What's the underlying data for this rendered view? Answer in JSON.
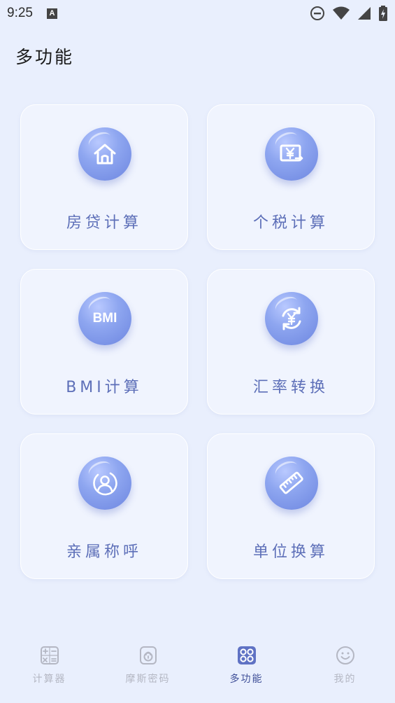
{
  "status_bar": {
    "time": "9:25",
    "notification_letter": "A"
  },
  "header": {
    "title": "多功能"
  },
  "cards": [
    {
      "label": "房贷计算",
      "icon": "house-icon"
    },
    {
      "label": "个税计算",
      "icon": "yuan-transfer-icon"
    },
    {
      "label": "BMI计算",
      "icon": "bmi-icon",
      "icon_text": "BMI"
    },
    {
      "label": "汇率转换",
      "icon": "currency-exchange-icon"
    },
    {
      "label": "亲属称呼",
      "icon": "person-icon"
    },
    {
      "label": "单位换算",
      "icon": "ruler-icon"
    }
  ],
  "tabbar": {
    "items": [
      {
        "label": "计算器",
        "icon": "calculator-icon",
        "active": false
      },
      {
        "label": "摩斯密码",
        "icon": "lock-icon",
        "active": false
      },
      {
        "label": "多功能",
        "icon": "grid-icon",
        "active": true
      },
      {
        "label": "我的",
        "icon": "smiley-icon",
        "active": false
      }
    ]
  },
  "colors": {
    "background": "#e9effd",
    "accent": "#6d86e0",
    "label": "#5d6fb8",
    "tab_active": "#3f4f98",
    "tab_inactive": "#b4b7c3"
  }
}
